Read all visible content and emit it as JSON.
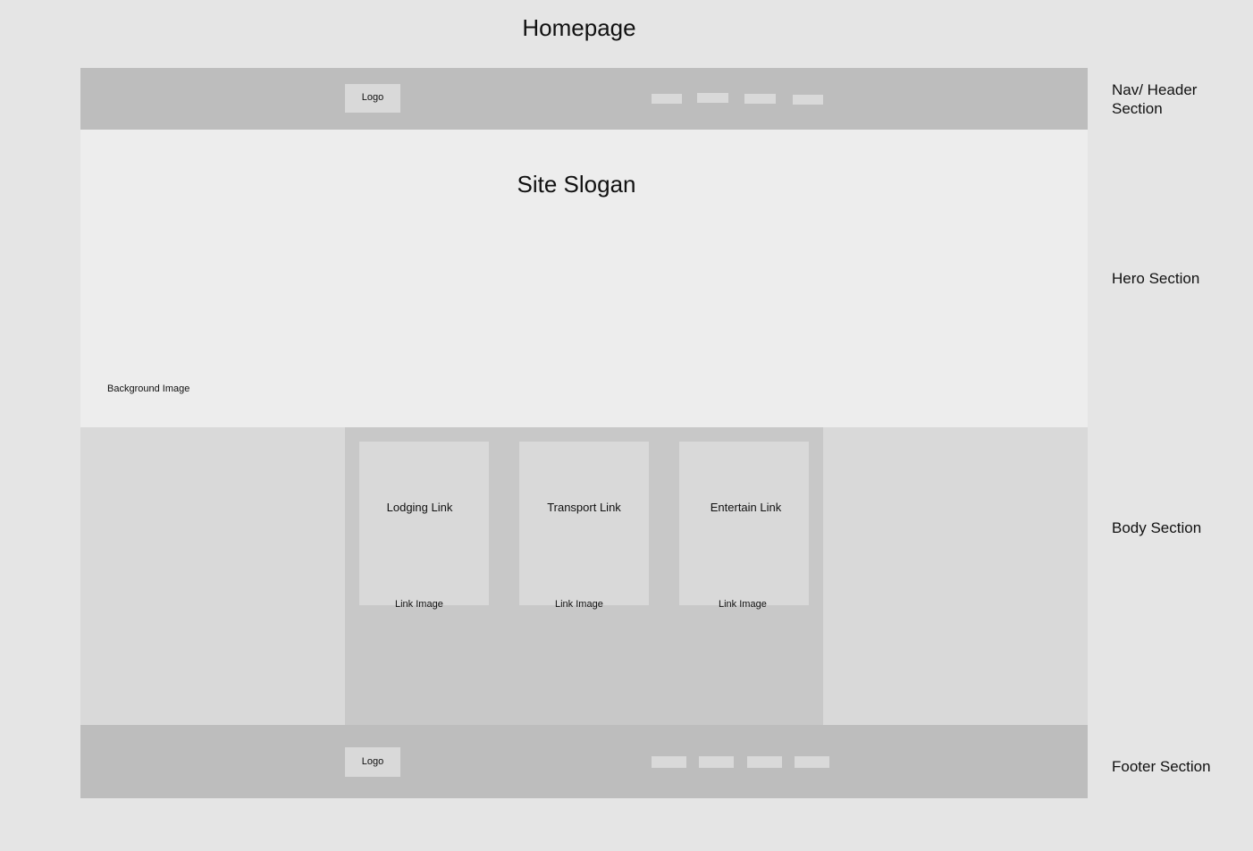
{
  "page_title": "Homepage",
  "nav": {
    "logo": "Logo",
    "link_placeholders": [
      "nav-link-1",
      "nav-link-2",
      "nav-link-3",
      "nav-link-4"
    ]
  },
  "hero": {
    "slogan": "Site Slogan",
    "background_label": "Background Image"
  },
  "body": {
    "cards": [
      {
        "title": "Lodging Link",
        "image": "Link Image"
      },
      {
        "title": "Transport Link",
        "image": "Link Image"
      },
      {
        "title": "Entertain Link",
        "image": "Link Image"
      }
    ]
  },
  "footer": {
    "logo": "Logo"
  },
  "section_labels": {
    "nav": "Nav/ Header\nSection",
    "hero": "Hero Section",
    "body": "Body Section",
    "footer": "Footer Section"
  },
  "colors": {
    "canvas": "#e5e5e5",
    "header_footer": "#bdbdbd",
    "hero": "#ededed",
    "body": "#d9d9d9",
    "body_center": "#c8c8c8",
    "card": "#d9d9d9"
  }
}
